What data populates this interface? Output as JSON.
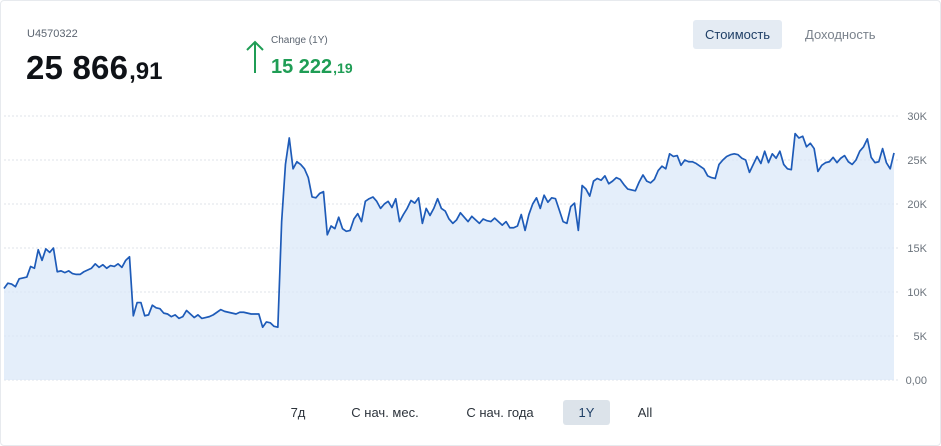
{
  "account": {
    "id": "U4570322",
    "value_int": "25 866",
    "value_dec": ",91"
  },
  "change": {
    "label": "Change (1Y)",
    "value_int": "15 222",
    "value_dec": ",19",
    "direction": "up",
    "color": "#1f9d55"
  },
  "toggles": [
    {
      "label": "Стоимость",
      "active": true
    },
    {
      "label": "Доходность",
      "active": false
    }
  ],
  "ranges": [
    {
      "label": "7д",
      "active": false
    },
    {
      "label": "С нач. мес.",
      "active": false
    },
    {
      "label": "С нач. года",
      "active": false
    },
    {
      "label": "1Y",
      "active": true
    },
    {
      "label": "All",
      "active": false
    }
  ],
  "chart_data": {
    "type": "area",
    "title": "",
    "xlabel": "",
    "ylabel": "",
    "ylim": [
      0,
      30000
    ],
    "yticks": [
      {
        "value": 0,
        "label": "0,00"
      },
      {
        "value": 5000,
        "label": "5K"
      },
      {
        "value": 10000,
        "label": "10K"
      },
      {
        "value": 15000,
        "label": "15K"
      },
      {
        "value": 20000,
        "label": "20K"
      },
      {
        "value": 25000,
        "label": "25K"
      },
      {
        "value": 30000,
        "label": "30K"
      }
    ],
    "grid": true,
    "line_color": "#1e5bb8",
    "fill_color": "#dbe8f8",
    "series": [
      {
        "values": [
          10400,
          11000,
          10900,
          10600,
          11500,
          11600,
          11700,
          12900,
          12700,
          14800,
          13600,
          14900,
          14500,
          15000,
          12300,
          12400,
          12200,
          12400,
          12100,
          12000,
          12000,
          12300,
          12500,
          12700,
          13200,
          12800,
          13100,
          12700,
          13000,
          12900,
          13200,
          12800,
          13600,
          14000,
          7300,
          8800,
          8800,
          7300,
          7400,
          8500,
          8200,
          8100,
          7600,
          7500,
          7200,
          7400,
          7000,
          7200,
          7900,
          7500,
          7100,
          7400,
          7000,
          7100,
          7200,
          7400,
          7700,
          8000,
          7800,
          7700,
          7600,
          7500,
          7700,
          7700,
          7600,
          7500,
          7500,
          7500,
          6000,
          6600,
          6500,
          6100,
          6000,
          18000,
          24500,
          27500,
          24000,
          24800,
          24500,
          24000,
          23000,
          20800,
          20700,
          21200,
          21400,
          16500,
          17500,
          17200,
          18500,
          17200,
          16900,
          17000,
          18300,
          18900,
          18000,
          20300,
          20600,
          20800,
          20300,
          19500,
          20000,
          20300,
          19600,
          20600,
          18000,
          18800,
          19500,
          20400,
          20100,
          20700,
          17800,
          19500,
          18700,
          19500,
          20600,
          19500,
          19200,
          18300,
          17800,
          18200,
          19000,
          18500,
          18000,
          18600,
          18200,
          17800,
          18300,
          18100,
          18000,
          18400,
          18000,
          17600,
          18000,
          17300,
          17300,
          17500,
          18800,
          17000,
          18800,
          20000,
          20700,
          19500,
          21000,
          20200,
          20700,
          20600,
          19300,
          18000,
          17800,
          19700,
          20100,
          17000,
          22100,
          21700,
          20900,
          22600,
          22900,
          22700,
          23200,
          22300,
          22600,
          23000,
          22800,
          22200,
          21700,
          21600,
          21500,
          22500,
          23300,
          22600,
          22400,
          22800,
          23800,
          24300,
          24000,
          25700,
          25400,
          25500,
          24400,
          25000,
          24800,
          24800,
          24600,
          24300,
          24000,
          23200,
          23000,
          22900,
          24500,
          25000,
          25400,
          25600,
          25700,
          25600,
          25200,
          25000,
          23600,
          24500,
          25400,
          24600,
          26000,
          24700,
          25700,
          25200,
          26000,
          24500,
          24000,
          23900,
          28000,
          27500,
          27700,
          26500,
          26900,
          26300,
          23700,
          24400,
          24700,
          24800,
          25300,
          24700,
          25200,
          25500,
          24800,
          24500,
          25000,
          26000,
          26500,
          27400,
          25300,
          24700,
          24800,
          26300,
          24700,
          24000,
          25800
        ]
      }
    ]
  }
}
